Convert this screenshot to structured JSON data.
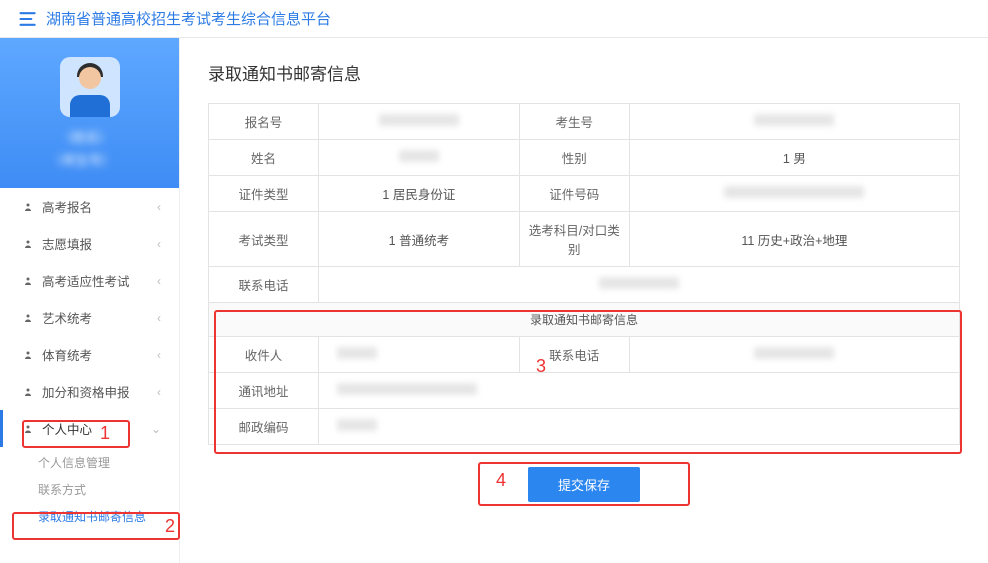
{
  "header": {
    "title": "湖南省普通高校招生考试考生综合信息平台"
  },
  "profile": {
    "name_placeholder": "（姓名）",
    "sub_placeholder": "（考生号）"
  },
  "sidebar": {
    "items": [
      {
        "label": "高考报名"
      },
      {
        "label": "志愿填报"
      },
      {
        "label": "高考适应性考试"
      },
      {
        "label": "艺术统考"
      },
      {
        "label": "体育统考"
      },
      {
        "label": "加分和资格申报"
      },
      {
        "label": "个人中心"
      }
    ],
    "sub_items": [
      {
        "label": "个人信息管理"
      },
      {
        "label": "联系方式"
      },
      {
        "label": "录取通知书邮寄信息"
      }
    ]
  },
  "page": {
    "title": "录取通知书邮寄信息",
    "rows": {
      "reg_no_label": "报名号",
      "exam_no_label": "考生号",
      "name_label": "姓名",
      "gender_label": "性别",
      "gender_value": "1 男",
      "idtype_label": "证件类型",
      "idtype_value": "1 居民身份证",
      "idno_label": "证件号码",
      "examtype_label": "考试类型",
      "examtype_value": "1 普通统考",
      "subject_label": "选考科目/对口类别",
      "subject_value": "11 历史+政治+地理",
      "phone_label": "联系电话"
    },
    "mail_section": {
      "title": "录取通知书邮寄信息",
      "recipient_label": "收件人",
      "phone_label": "联系电话",
      "address_label": "通讯地址",
      "postcode_label": "邮政编码"
    },
    "submit_label": "提交保存"
  },
  "annotations": {
    "n1": "1",
    "n2": "2",
    "n3": "3",
    "n4": "4"
  }
}
